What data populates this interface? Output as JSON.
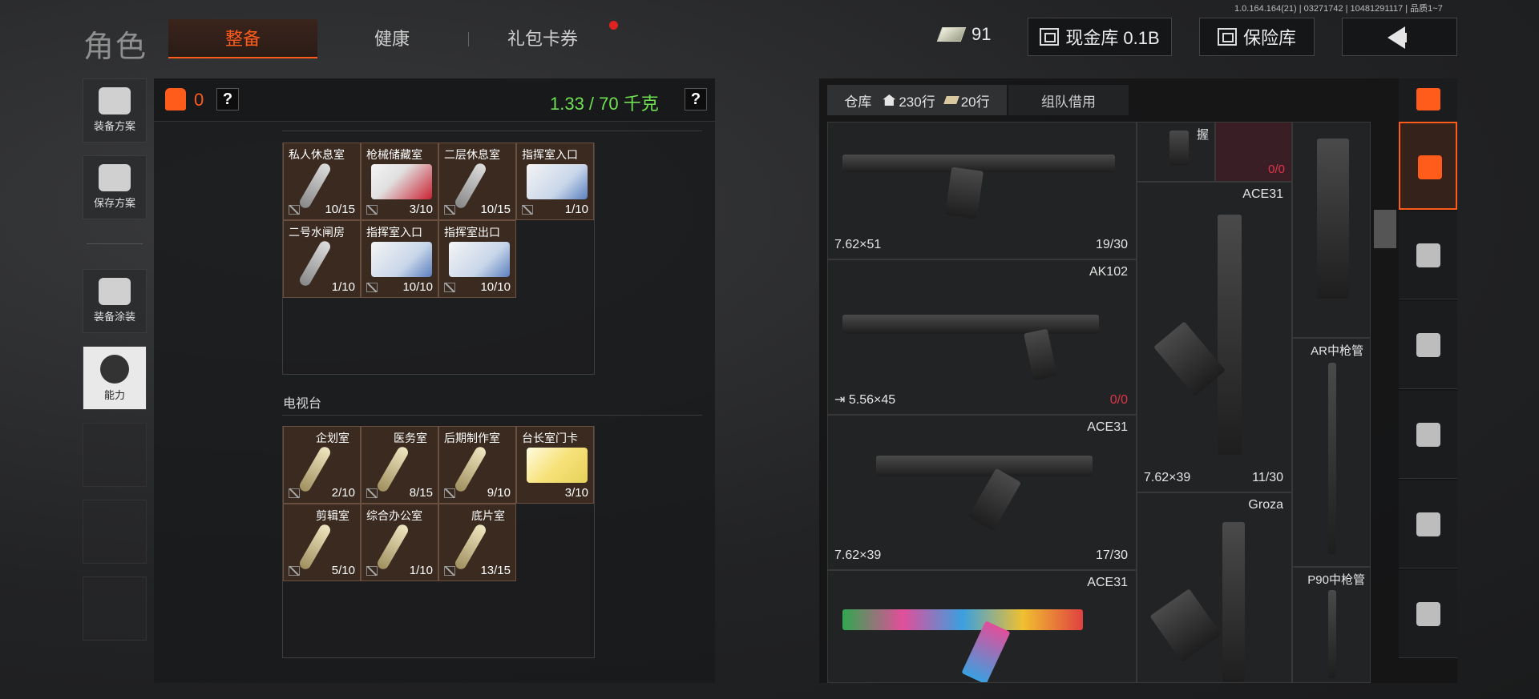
{
  "version": "1.0.164.164(21) | 03271742 | 10481291117 | 品质1~7",
  "role_title": "角色",
  "tabs": [
    {
      "label": "整备",
      "active": true
    },
    {
      "label": "健康",
      "active": false
    },
    {
      "label": "礼包卡券",
      "active": false
    }
  ],
  "top": {
    "cash": "91",
    "cash_vault": "现金库 0.1B",
    "safe": "保险库",
    "cash_icon": "cash-stack-icon",
    "vault_icon": "vault-icon",
    "safe_icon": "safe-icon",
    "back_icon": "back-arrow-icon"
  },
  "sidebar": {
    "items": [
      {
        "label": "装备方案",
        "icon": "vest-loadout-icon"
      },
      {
        "label": "保存方案",
        "icon": "download-save-icon"
      },
      {
        "label": "装备涂装",
        "icon": "helmet-paint-icon"
      },
      {
        "label": "能力",
        "icon": "ability-bolt-icon"
      }
    ]
  },
  "equip": {
    "vest_count": "0",
    "help": "?",
    "weight": "1.33 / 70 千克"
  },
  "keys_upper": [
    {
      "name": "私人休息室",
      "count": "10/15",
      "type": "key"
    },
    {
      "name": "枪械储藏室",
      "count": "3/10",
      "type": "card-red"
    },
    {
      "name": "二层休息室",
      "count": "10/15",
      "type": "key"
    },
    {
      "name": "指挥室入口",
      "count": "1/10",
      "type": "card-blue"
    },
    {
      "name": "二号水闸房",
      "count": "1/10",
      "type": "key"
    },
    {
      "name": "指挥室入口",
      "count": "10/10",
      "type": "card-blue"
    },
    {
      "name": "指挥室出口",
      "count": "10/10",
      "type": "card-blue"
    }
  ],
  "section_tv": "电视台",
  "keys_lower": [
    {
      "name": "企划室",
      "count": "2/10",
      "type": "key-gold"
    },
    {
      "name": "医务室",
      "count": "8/15",
      "type": "key-gold"
    },
    {
      "name": "后期制作室",
      "count": "9/10",
      "type": "key-gold"
    },
    {
      "name": "台长室门卡",
      "count": "3/10",
      "type": "card-yellow"
    },
    {
      "name": "剪辑室",
      "count": "5/10",
      "type": "key-gold"
    },
    {
      "name": "综合办公室",
      "count": "1/10",
      "type": "key-gold"
    },
    {
      "name": "底片室",
      "count": "13/15",
      "type": "key-gold"
    }
  ],
  "warehouse": {
    "tab_label": "仓库",
    "rows_label": "230行",
    "ticket_label": "20行",
    "team_label": "组队借用"
  },
  "weapons": [
    {
      "name": "",
      "caliber": "7.62×51",
      "count": "19/30"
    },
    {
      "name": "AK102",
      "caliber": "5.56×45",
      "count": "0/0"
    },
    {
      "name": "ACE31",
      "caliber": "7.62×39",
      "count": "17/30"
    },
    {
      "name": "ACE31",
      "caliber": "",
      "count": ""
    }
  ],
  "col2": {
    "grip_label": "握",
    "grip_count": "0/0",
    "ace_name": "ACE31",
    "ace_caliber": "7.62×39",
    "ace_count": "11/30",
    "groza_name": "Groza"
  },
  "col3": {
    "ar_barrel": "AR中枪管",
    "p90_barrel": "P90中枪管"
  },
  "categories": [
    {
      "icon": "all-items-icon",
      "active": true
    },
    {
      "icon": "helmet-icon",
      "active": false
    },
    {
      "icon": "rifle-icon",
      "active": false
    },
    {
      "icon": "magazine-icon",
      "active": false
    },
    {
      "icon": "ammo-icon",
      "active": false
    },
    {
      "icon": "scope-icon",
      "active": false
    }
  ],
  "colors": {
    "accent": "#ff5b1a",
    "weight_green": "#6fe052",
    "zero_red": "#e0344a"
  }
}
